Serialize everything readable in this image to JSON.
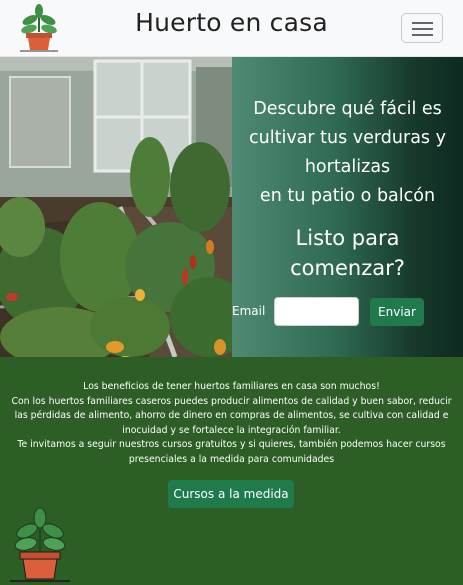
{
  "navbar": {
    "title": "Huerto en casa",
    "logo_icon": "potted-plant-icon",
    "toggler_icon": "hamburger-menu-icon"
  },
  "hero": {
    "headline_lines": [
      "Descubre qué fácil es",
      "cultivar tus verduras y",
      "hortalizas",
      "en tu patio o balcón"
    ],
    "question_lines": [
      "Listo para",
      "comenzar?"
    ],
    "email_label": "Email",
    "email_value": "",
    "send_label": "Enviar"
  },
  "footer": {
    "lines": [
      "Los beneficios de tener huertos familiares en casa son muchos!",
      "Con los huertos familiares caseros puedes producir alimentos de calidad y buen sabor, reducir",
      "las pérdidas de alimento, ahorro de dinero en compras de alimentos, se cultiva con calidad e",
      "inocuidad y se fortalece la integración familiar.",
      "Te invitamos a seguir nuestros cursos gratuitos y si quieres, también podemos hacer cursos",
      "presenciales a la medida para comunidades"
    ],
    "courses_label": "Cursos a la medida",
    "logo_icon": "potted-plant-icon"
  },
  "colors": {
    "navbar_bg": "#f8f9fa",
    "button_green": "#1f7a4c",
    "footer_green": "#2c5e25",
    "pot_terracotta": "#d9603b",
    "leaf_green": "#3f8f47"
  }
}
